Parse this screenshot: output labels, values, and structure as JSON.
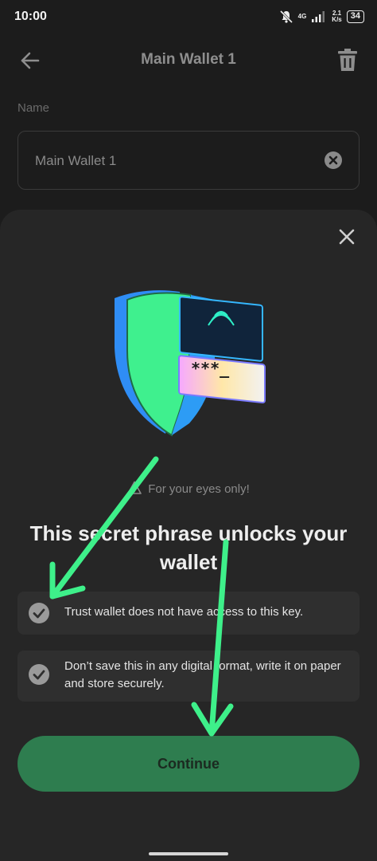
{
  "status_bar": {
    "time": "10:00",
    "network": "4G",
    "speed_value": "2.1",
    "speed_unit": "K/s",
    "battery": "34",
    "icons": [
      "mute-bell-icon",
      "signal-icon",
      "battery-icon"
    ]
  },
  "header": {
    "title": "Main Wallet 1",
    "back_icon": "arrow-left-icon",
    "delete_icon": "trash-icon"
  },
  "name_field": {
    "label": "Name",
    "value": "Main Wallet 1",
    "clear_icon": "clear-circle-icon"
  },
  "sheet": {
    "close_icon": "close-icon",
    "illustration": "shield-password-illustration",
    "illustration_text": "***_",
    "eyes_only_text": "For your eyes only!",
    "headline": "This secret phrase unlocks your wallet",
    "items": [
      {
        "text": "Trust wallet does not have access to this key.",
        "icon": "check-circle-icon"
      },
      {
        "text": "Don’t save this in any digital format, write it on paper and store securely.",
        "icon": "check-circle-icon"
      }
    ],
    "continue_label": "Continue"
  },
  "colors": {
    "background": "#1c1c1c",
    "sheet": "#262626",
    "card": "#2f2f2f",
    "button": "#2e7d4f",
    "annotation_arrow": "#3ef08a"
  }
}
